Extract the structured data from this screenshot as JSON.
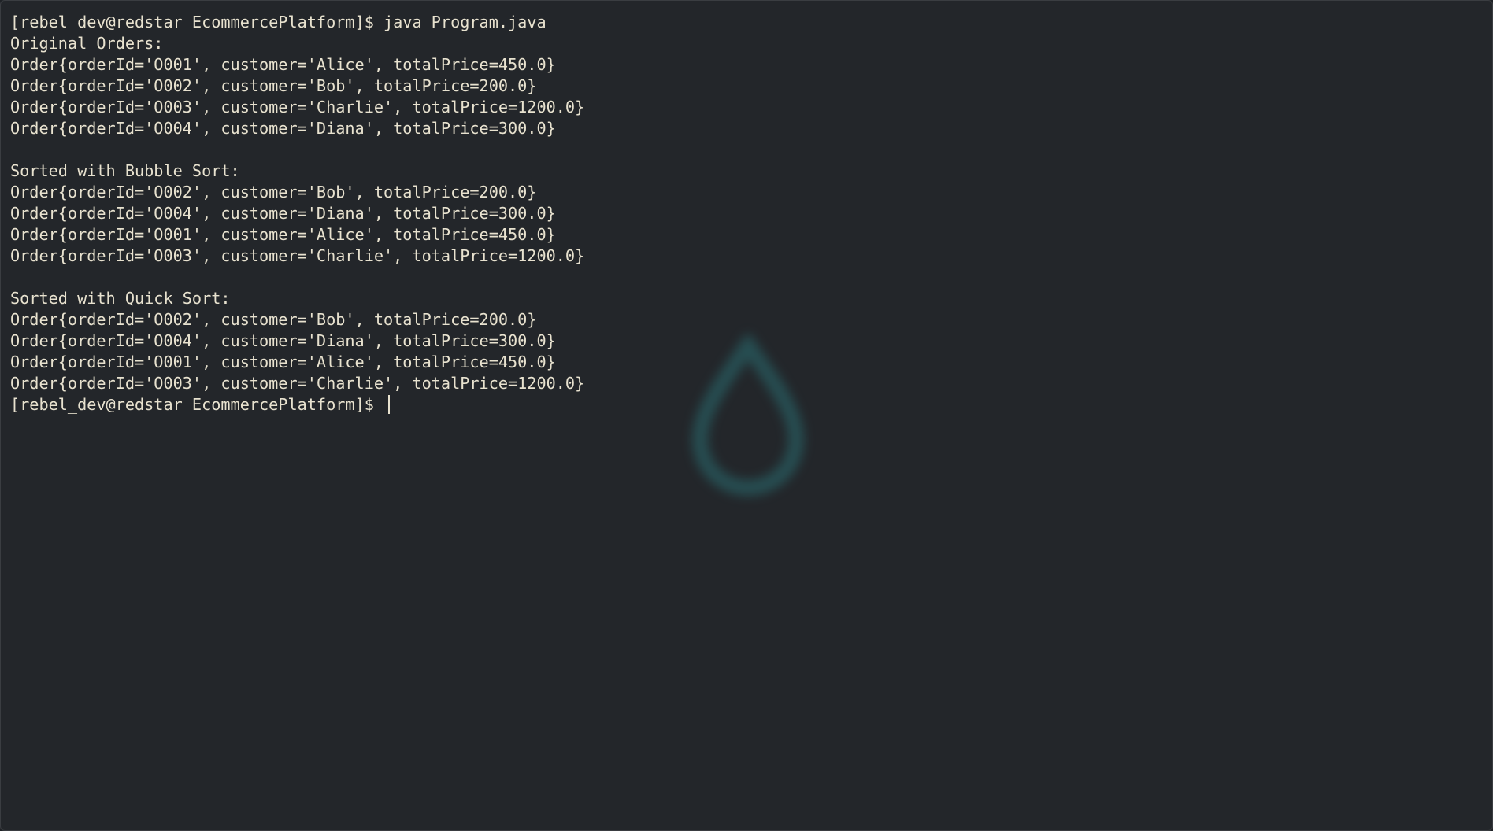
{
  "terminal": {
    "lines": [
      "[rebel_dev@redstar EcommercePlatform]$ java Program.java",
      "Original Orders:",
      "Order{orderId='O001', customer='Alice', totalPrice=450.0}",
      "Order{orderId='O002', customer='Bob', totalPrice=200.0}",
      "Order{orderId='O003', customer='Charlie', totalPrice=1200.0}",
      "Order{orderId='O004', customer='Diana', totalPrice=300.0}",
      "",
      "Sorted with Bubble Sort:",
      "Order{orderId='O002', customer='Bob', totalPrice=200.0}",
      "Order{orderId='O004', customer='Diana', totalPrice=300.0}",
      "Order{orderId='O001', customer='Alice', totalPrice=450.0}",
      "Order{orderId='O003', customer='Charlie', totalPrice=1200.0}",
      "",
      "Sorted with Quick Sort:",
      "Order{orderId='O002', customer='Bob', totalPrice=200.0}",
      "Order{orderId='O004', customer='Diana', totalPrice=300.0}",
      "Order{orderId='O001', customer='Alice', totalPrice=450.0}",
      "Order{orderId='O003', customer='Charlie', totalPrice=1200.0}"
    ],
    "prompt": "[rebel_dev@redstar EcommercePlatform]$ "
  },
  "colors": {
    "background": "#23262a",
    "text": "#e8e2cf",
    "watermark": "#2a6f73"
  },
  "icons": {
    "watermark": "droplet-icon"
  }
}
